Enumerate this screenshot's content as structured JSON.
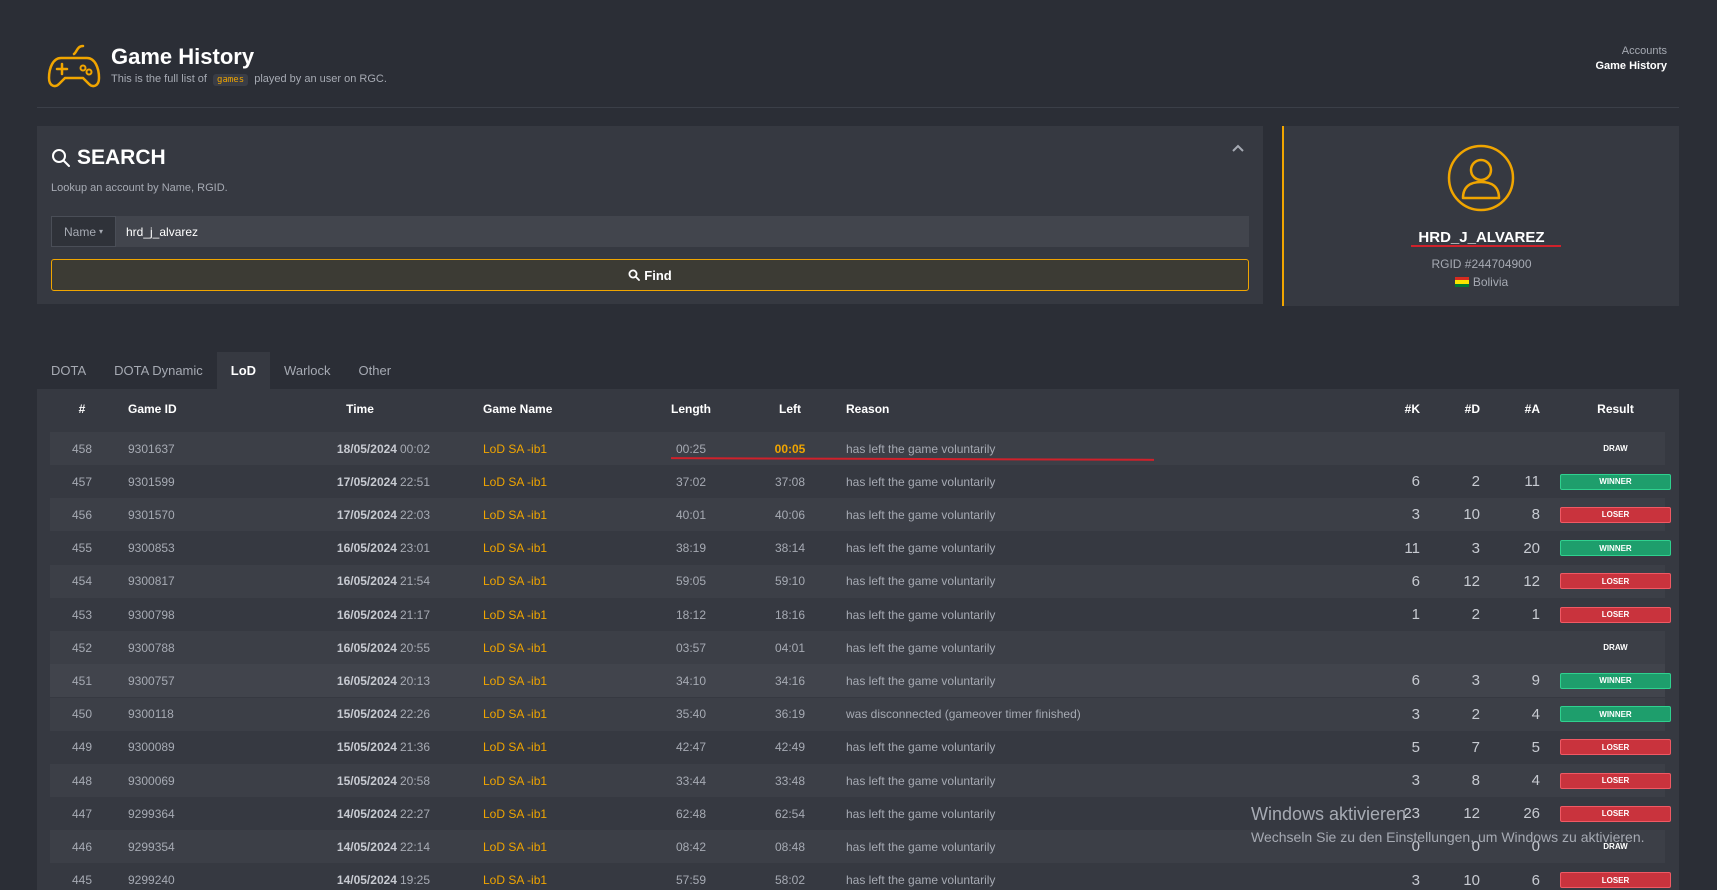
{
  "header": {
    "title": "Game History",
    "subtitle_before": "This is the full list of",
    "subtitle_code": "games",
    "subtitle_after": "played by an user on RGC.",
    "breadcrumb_1": "Accounts",
    "breadcrumb_2": "Game History",
    "logo_icon": "gamepad-icon"
  },
  "search": {
    "title": "SEARCH",
    "help": "Lookup an account by Name, RGID.",
    "dropdown_value": "Name",
    "input_value": "hrd_j_alvarez",
    "find_label": "Find"
  },
  "profile": {
    "name": "HRD_J_ALVAREZ",
    "rgid": "RGID #244704900",
    "country": "Bolivia",
    "flag_colors": [
      "#d52b1e",
      "#f9e300",
      "#007934"
    ]
  },
  "tabs": [
    {
      "label": "DOTA"
    },
    {
      "label": "DOTA Dynamic"
    },
    {
      "label": "LoD"
    },
    {
      "label": "Warlock"
    },
    {
      "label": "Other"
    }
  ],
  "active_tab": "LoD",
  "table": {
    "headers": {
      "num": "#",
      "gid": "Game ID",
      "time": "Time",
      "gname": "Game Name",
      "len": "Length",
      "left": "Left",
      "reason": "Reason",
      "k": "#K",
      "d": "#D",
      "a": "#A",
      "res": "Result"
    },
    "rows": [
      {
        "num": "458",
        "gid": "9301637",
        "date": "18/05/2024",
        "clock": "00:02",
        "gname": "LoD SA -ib1",
        "len": "00:25",
        "left": "00:05",
        "reason": "has left the game voluntarily",
        "k": "",
        "d": "",
        "a": "",
        "res": "DRAW"
      },
      {
        "num": "457",
        "gid": "9301599",
        "date": "17/05/2024",
        "clock": "22:51",
        "gname": "LoD SA -ib1",
        "len": "37:02",
        "left": "37:08",
        "reason": "has left the game voluntarily",
        "k": "6",
        "d": "2",
        "a": "11",
        "res": "WINNER"
      },
      {
        "num": "456",
        "gid": "9301570",
        "date": "17/05/2024",
        "clock": "22:03",
        "gname": "LoD SA -ib1",
        "len": "40:01",
        "left": "40:06",
        "reason": "has left the game voluntarily",
        "k": "3",
        "d": "10",
        "a": "8",
        "res": "LOSER"
      },
      {
        "num": "455",
        "gid": "9300853",
        "date": "16/05/2024",
        "clock": "23:01",
        "gname": "LoD SA -ib1",
        "len": "38:19",
        "left": "38:14",
        "reason": "has left the game voluntarily",
        "k": "11",
        "d": "3",
        "a": "20",
        "res": "WINNER"
      },
      {
        "num": "454",
        "gid": "9300817",
        "date": "16/05/2024",
        "clock": "21:54",
        "gname": "LoD SA -ib1",
        "len": "59:05",
        "left": "59:10",
        "reason": "has left the game voluntarily",
        "k": "6",
        "d": "12",
        "a": "12",
        "res": "LOSER"
      },
      {
        "num": "453",
        "gid": "9300798",
        "date": "16/05/2024",
        "clock": "21:17",
        "gname": "LoD SA -ib1",
        "len": "18:12",
        "left": "18:16",
        "reason": "has left the game voluntarily",
        "k": "1",
        "d": "2",
        "a": "1",
        "res": "LOSER"
      },
      {
        "num": "452",
        "gid": "9300788",
        "date": "16/05/2024",
        "clock": "20:55",
        "gname": "LoD SA -ib1",
        "len": "03:57",
        "left": "04:01",
        "reason": "has left the game voluntarily",
        "k": "",
        "d": "",
        "a": "",
        "res": "DRAW"
      },
      {
        "num": "451",
        "gid": "9300757",
        "date": "16/05/2024",
        "clock": "20:13",
        "gname": "LoD SA -ib1",
        "len": "34:10",
        "left": "34:16",
        "reason": "has left the game voluntarily",
        "k": "6",
        "d": "3",
        "a": "9",
        "res": "WINNER"
      },
      {
        "num": "450",
        "gid": "9300118",
        "date": "15/05/2024",
        "clock": "22:26",
        "gname": "LoD SA -ib1",
        "len": "35:40",
        "left": "36:19",
        "reason": "was disconnected (gameover timer finished)",
        "k": "3",
        "d": "2",
        "a": "4",
        "res": "WINNER"
      },
      {
        "num": "449",
        "gid": "9300089",
        "date": "15/05/2024",
        "clock": "21:36",
        "gname": "LoD SA -ib1",
        "len": "42:47",
        "left": "42:49",
        "reason": "has left the game voluntarily",
        "k": "5",
        "d": "7",
        "a": "5",
        "res": "LOSER"
      },
      {
        "num": "448",
        "gid": "9300069",
        "date": "15/05/2024",
        "clock": "20:58",
        "gname": "LoD SA -ib1",
        "len": "33:44",
        "left": "33:48",
        "reason": "has left the game voluntarily",
        "k": "3",
        "d": "8",
        "a": "4",
        "res": "LOSER"
      },
      {
        "num": "447",
        "gid": "9299364",
        "date": "14/05/2024",
        "clock": "22:27",
        "gname": "LoD SA -ib1",
        "len": "62:48",
        "left": "62:54",
        "reason": "has left the game voluntarily",
        "k": "23",
        "d": "12",
        "a": "26",
        "res": "LOSER"
      },
      {
        "num": "446",
        "gid": "9299354",
        "date": "14/05/2024",
        "clock": "22:14",
        "gname": "LoD SA -ib1",
        "len": "08:42",
        "left": "08:48",
        "reason": "has left the game voluntarily",
        "k": "0",
        "d": "0",
        "a": "0",
        "res": "DRAW"
      },
      {
        "num": "445",
        "gid": "9299240",
        "date": "14/05/2024",
        "clock": "19:25",
        "gname": "LoD SA -ib1",
        "len": "57:59",
        "left": "58:02",
        "reason": "has left the game voluntarily",
        "k": "3",
        "d": "10",
        "a": "6",
        "res": "LOSER"
      }
    ]
  },
  "watermark": {
    "line1": "Windows aktivieren",
    "line2": "Wechseln Sie zu den Einstellungen, um Windows zu aktivieren."
  },
  "colors": {
    "accent": "#f0a500",
    "winner": "#1e9e6c",
    "loser": "#c9333d",
    "annotation": "#d0212b"
  }
}
